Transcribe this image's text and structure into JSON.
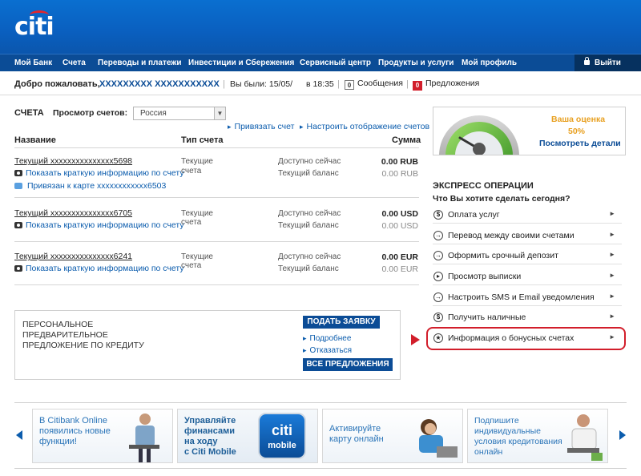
{
  "header": {
    "logo_text": "citi"
  },
  "nav": {
    "items": [
      "Мой Банк",
      "Счета",
      "Переводы и платежи",
      "Инвестиции и Сбережения",
      "Сервисный центр",
      "Продукты и услуги",
      "Мой профиль"
    ],
    "logout": "Выйти"
  },
  "welcome": {
    "greeting": "Добро пожаловать,",
    "username": "XXXXXXXXX XXXXXXXXXXX",
    "last_visit": "Вы были: 15/05/",
    "time": "в 18:35",
    "messages_count": "0",
    "messages": "Сообщения",
    "offers_count": "0",
    "offers": "Предложения"
  },
  "accounts": {
    "title": "СЧЕТА",
    "view_label": "Просмотр счетов:",
    "view_selected": "Россия",
    "link_account": "Привязать счет",
    "configure_view": "Настроить отображение счетов",
    "columns": {
      "name": "Название",
      "type": "Тип счета",
      "amount": "Сумма"
    },
    "rows": [
      {
        "name": "Текущий xxxxxxxxxxxxxxx5698",
        "info": "Показать краткую информацию по счету",
        "card": "Привязан к карте xxxxxxxxxxxx6503",
        "type_line1": "Текущие",
        "type_line2": "счета",
        "avail_label": "Доступно сейчас",
        "balance_label": "Текущий баланс",
        "avail": "0.00 RUB",
        "balance": "0.00 RUB"
      },
      {
        "name": "Текущий xxxxxxxxxxxxxxx6705",
        "info": "Показать краткую информацию по счету",
        "type_line1": "Текущие",
        "type_line2": "счета",
        "avail_label": "Доступно сейчас",
        "balance_label": "Текущий баланс",
        "avail": "0.00 USD",
        "balance": "0.00 USD"
      },
      {
        "name": "Текущий xxxxxxxxxxxxxxx6241",
        "info": "Показать краткую информацию по счету",
        "type_line1": "Текущие",
        "type_line2": "счета",
        "avail_label": "Доступно сейчас",
        "balance_label": "Текущий баланс",
        "avail": "0.00 EUR",
        "balance": "0.00 EUR"
      }
    ]
  },
  "offer": {
    "line1": "ПЕРСОНАЛЬНОЕ",
    "line2": "ПРЕДВАРИТЕЛЬНОЕ",
    "line3": "ПРЕДЛОЖЕНИЕ ПО КРЕДИТУ",
    "apply": "ПОДАТЬ ЗАЯВКУ",
    "details": "Подробнее",
    "decline": "Отказаться",
    "all_offers": "ВСЕ ПРЕДЛОЖЕНИЯ"
  },
  "rating": {
    "title": "Ваша оценка",
    "percent": "50%",
    "value": 0.5,
    "details": "Посмотреть детали"
  },
  "express": {
    "title": "ЭКСПРЕСС ОПЕРАЦИИ",
    "question": "Что Вы хотите сделать сегодня?",
    "items": [
      {
        "icon": "$",
        "label": "Оплата услуг"
      },
      {
        "icon": "→",
        "label": "Перевод между своими счетами"
      },
      {
        "icon": "→",
        "label": "Оформить срочный депозит"
      },
      {
        "icon": "▸",
        "label": "Просмотр выписки"
      },
      {
        "icon": "→",
        "label": "Настроить SMS и Email уведомления"
      },
      {
        "icon": "$",
        "label": "Получить наличные"
      },
      {
        "icon": "★",
        "label": "Информация о бонусных счетах"
      }
    ]
  },
  "banners": [
    {
      "line1": "В Citibank Online",
      "line2": "появились новые",
      "line3": "функции!"
    },
    {
      "line1": "Управляйте",
      "line2": "финансами",
      "line3": "на ходу",
      "line4": "с Citi Mobile",
      "badge1": "citi",
      "badge2": "mobile"
    },
    {
      "line1": "Активируйте",
      "line2": "карту онлайн"
    },
    {
      "line1": "Подпишите",
      "line2": "индивидуальные",
      "line3": "условия кредитования",
      "line4": "онлайн"
    }
  ],
  "colors": {
    "header": "#0a5fbf",
    "nav": "#0b4c96",
    "link": "#0b5cad",
    "highlight": "#d21e2b",
    "rating": "#e8a020"
  }
}
